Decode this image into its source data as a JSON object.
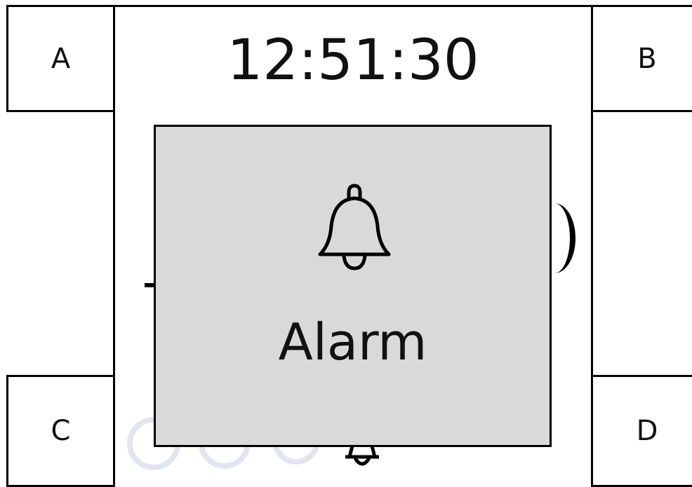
{
  "clock": {
    "time": "12:51:30"
  },
  "corner_buttons": {
    "a": "A",
    "b": "B",
    "c": "C",
    "d": "D"
  },
  "alarm_popup": {
    "icon": "bell-icon",
    "label": "Alarm",
    "background_color": "#d9d9d9"
  },
  "pager": {
    "dots": 3,
    "dot_color": "#e1e6ee"
  }
}
